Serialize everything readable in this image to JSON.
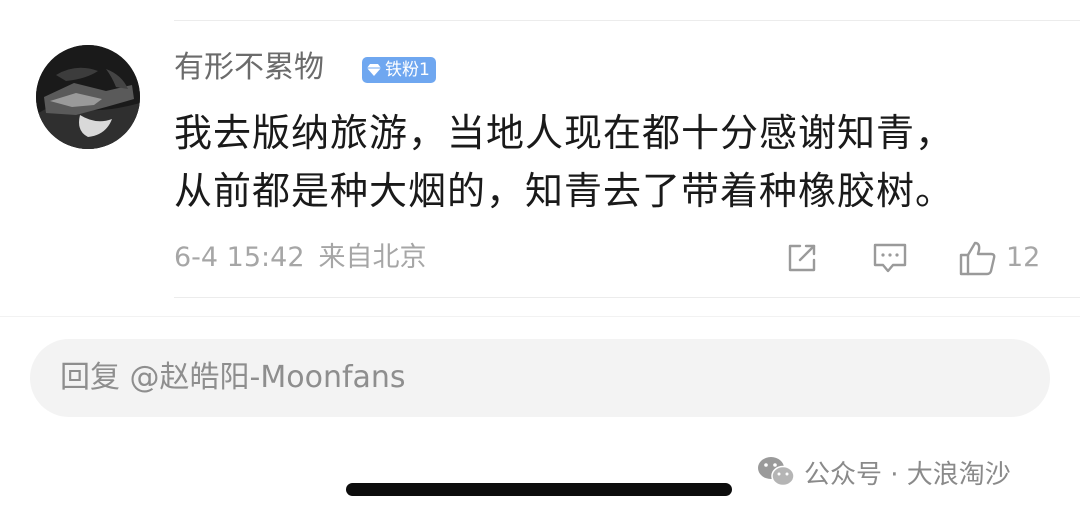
{
  "comment": {
    "username": "有形不累物",
    "badge_label": "铁粉1",
    "text_lines": [
      "我去版纳旅游，当地人现在都十分感谢知青，",
      "从前都是种大烟的，知青去了带着种橡胶树。"
    ],
    "timestamp": "6-4 15:42",
    "location": "来自北京",
    "like_count": "12",
    "badge_color": "#6fa7f0"
  },
  "reply": {
    "placeholder": "回复 @赵皓阳-Moonfans"
  },
  "watermark": {
    "text": "公众号 · 大浪淘沙"
  }
}
